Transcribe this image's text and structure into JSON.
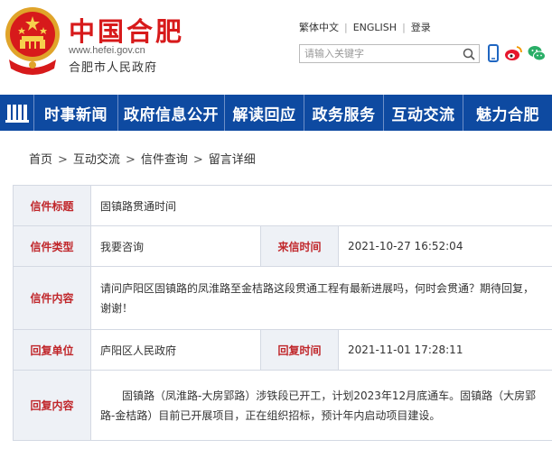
{
  "header": {
    "site_title": "中国合肥",
    "site_url": "www.hefei.gov.cn",
    "site_org": "合肥市人民政府",
    "toplinks": [
      "繁体中文",
      "ENGLISH",
      "登录"
    ],
    "search_placeholder": "请输入关键字"
  },
  "nav": {
    "items": [
      "时事新闻",
      "政府信息公开",
      "解读回应",
      "政务服务",
      "互动交流",
      "魅力合肥"
    ]
  },
  "breadcrumb": [
    "首页",
    "互动交流",
    "信件查询",
    "留言详细"
  ],
  "letter": {
    "title_label": "信件标题",
    "title": "固镇路贯通时间",
    "type_label": "信件类型",
    "type": "我要咨询",
    "date_label": "来信时间",
    "date": "2021-10-27 16:52:04",
    "content_label": "信件内容",
    "content": "请问庐阳区固镇路的凤淮路至金桔路这段贯通工程有最新进展吗，何时会贯通？期待回复，谢谢！",
    "unit_label": "回复单位",
    "unit": "庐阳区人民政府",
    "reply_date_label": "回复时间",
    "reply_date": "2021-11-01 17:28:11",
    "reply_label": "回复内容",
    "reply": "固镇路（凤淮路-大房郢路）涉铁段已开工，计划2023年12月底通车。固镇路（大房郢路-金桔路）目前已开展项目，正在组织招标，预计年内启动项目建设。"
  },
  "colors": {
    "nav_bg": "#0e4aa1",
    "title_red": "#d71a1b",
    "label_red": "#c0262a",
    "label_bg": "#eef1f6"
  }
}
